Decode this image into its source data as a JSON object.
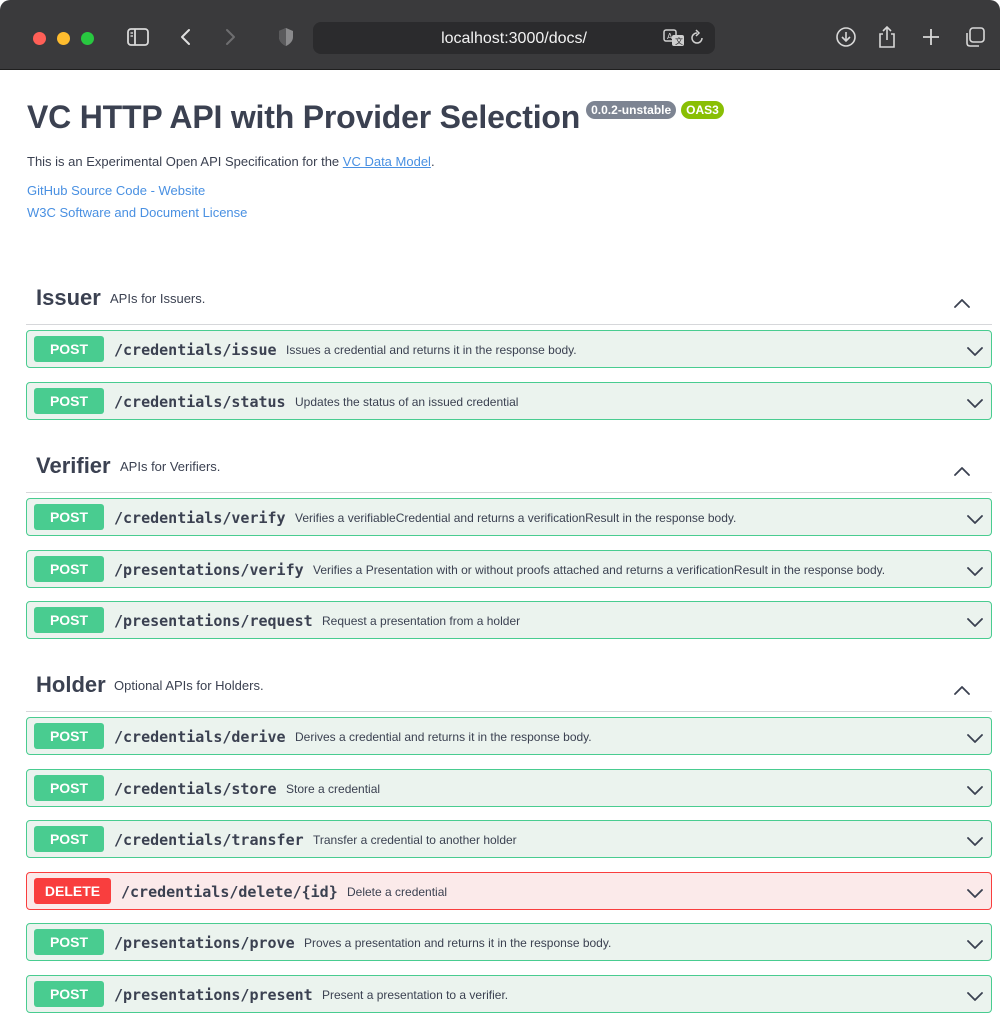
{
  "browser": {
    "url": "localhost:3000/docs/",
    "icons": [
      "sidebar-icon",
      "back-icon",
      "forward-icon",
      "shield-icon",
      "translate-icon",
      "reload-icon",
      "download-icon",
      "share-icon",
      "new-tab-icon",
      "tabs-overview-icon"
    ]
  },
  "info": {
    "title": "VC HTTP API with Provider Selection",
    "version": "0.0.2-unstable",
    "oas": "OAS3",
    "description_prefix": "This is an Experimental Open API Specification for the ",
    "description_link": "VC Data Model",
    "description_suffix": ".",
    "links": [
      "GitHub Source Code - Website",
      "W3C Software and Document License"
    ]
  },
  "colors": {
    "post": "#49cc90",
    "delete": "#f93e3e",
    "link": "#4990e2"
  },
  "sections": [
    {
      "name": "Issuer",
      "description": "APIs for Issuers.",
      "operations": [
        {
          "method": "POST",
          "path": "/credentials/issue",
          "summary": "Issues a credential and returns it in the response body."
        },
        {
          "method": "POST",
          "path": "/credentials/status",
          "summary": "Updates the status of an issued credential"
        }
      ]
    },
    {
      "name": "Verifier",
      "description": "APIs for Verifiers.",
      "operations": [
        {
          "method": "POST",
          "path": "/credentials/verify",
          "summary": "Verifies a verifiableCredential and returns a verificationResult in the response body."
        },
        {
          "method": "POST",
          "path": "/presentations/verify",
          "summary": "Verifies a Presentation with or without proofs attached and returns a verificationResult in the response body."
        },
        {
          "method": "POST",
          "path": "/presentations/request",
          "summary": "Request a presentation from a holder"
        }
      ]
    },
    {
      "name": "Holder",
      "description": "Optional APIs for Holders.",
      "operations": [
        {
          "method": "POST",
          "path": "/credentials/derive",
          "summary": "Derives a credential and returns it in the response body."
        },
        {
          "method": "POST",
          "path": "/credentials/store",
          "summary": "Store a credential"
        },
        {
          "method": "POST",
          "path": "/credentials/transfer",
          "summary": "Transfer a credential to another holder"
        },
        {
          "method": "DELETE",
          "path": "/credentials/delete/{id}",
          "summary": "Delete a credential"
        },
        {
          "method": "POST",
          "path": "/presentations/prove",
          "summary": "Proves a presentation and returns it in the response body."
        },
        {
          "method": "POST",
          "path": "/presentations/present",
          "summary": "Present a presentation to a verifier."
        }
      ]
    }
  ]
}
